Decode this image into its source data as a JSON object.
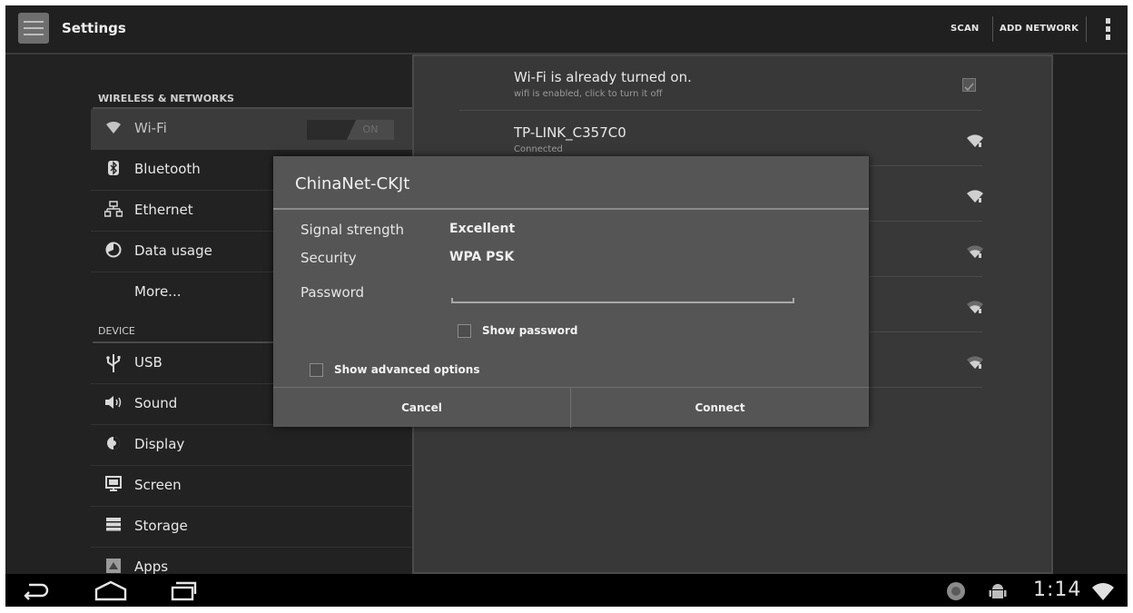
{
  "action_bar": {
    "title": "Settings",
    "actions": [
      "SCAN",
      "ADD NETWORK"
    ]
  },
  "sidebar": {
    "categories": [
      "WIRELESS & NETWORKS",
      "DEVICE"
    ],
    "items": [
      {
        "label": "Wi-Fi",
        "icon": "wifi-icon",
        "toggle": "ON",
        "selected": true
      },
      {
        "label": "Bluetooth",
        "icon": "bluetooth-icon"
      },
      {
        "label": "Ethernet",
        "icon": "ethernet-icon"
      },
      {
        "label": "Data usage",
        "icon": "data-usage-icon"
      },
      {
        "label": "More..."
      },
      {
        "label": "USB",
        "icon": "usb-icon"
      },
      {
        "label": "Sound",
        "icon": "sound-icon"
      },
      {
        "label": "Display",
        "icon": "display-icon"
      },
      {
        "label": "Screen",
        "icon": "screen-icon"
      },
      {
        "label": "Storage",
        "icon": "storage-icon"
      },
      {
        "label": "Apps",
        "icon": "apps-icon"
      }
    ]
  },
  "wifi_list": {
    "status_title": "Wi-Fi is already turned on.",
    "status_sub": "wifi is enabled, click to turn it off",
    "networks": [
      {
        "name": "TP-LINK_C357C0",
        "status": "Connected"
      }
    ]
  },
  "dialog": {
    "title": "ChinaNet-CKJt",
    "signal_label": "Signal strength",
    "signal_value": "Excellent",
    "security_label": "Security",
    "security_value": "WPA PSK",
    "password_label": "Password",
    "password_value": "",
    "show_password": "Show password",
    "show_advanced": "Show advanced options",
    "cancel": "Cancel",
    "connect": "Connect"
  },
  "status_bar": {
    "time": "1:14"
  },
  "colors": {
    "background": "#1e1e1e",
    "dialog": "#555555",
    "selected": "#3b3b3b"
  }
}
